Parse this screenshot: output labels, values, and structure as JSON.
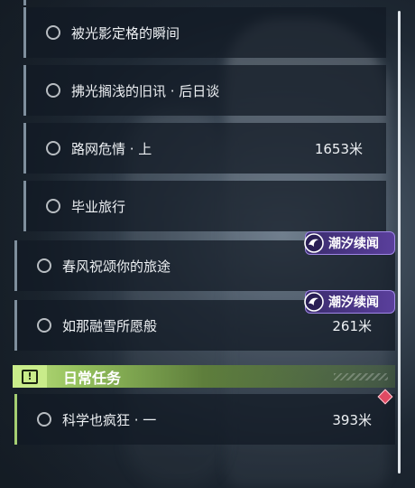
{
  "quests": [
    {
      "label": "被光影定格的瞬间",
      "distance": ""
    },
    {
      "label": "拂光搁浅的旧讯 · 后日谈",
      "distance": ""
    },
    {
      "label": "路网危情 · 上",
      "distance": "1653米"
    },
    {
      "label": "毕业旅行",
      "distance": ""
    },
    {
      "label": "春风祝颂你的旅途",
      "distance": "",
      "badge": "潮汐续闻"
    },
    {
      "label": "如那融雪所愿般",
      "distance": "261米",
      "badge": "潮汐续闻"
    }
  ],
  "daily_section": {
    "title": "日常任务",
    "icon": "exclamation-icon",
    "accent_color": "#a5cf72",
    "quests": [
      {
        "label": "科学也疯狂 · 一",
        "distance": "393米"
      }
    ]
  },
  "colors": {
    "badge_bg": "#5a3f9c",
    "marker": "#e04a63"
  }
}
